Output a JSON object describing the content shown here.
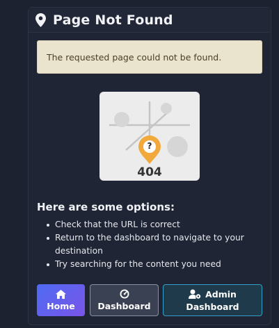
{
  "panel": {
    "title": "Page Not Found",
    "title_icon": "map-pin-icon"
  },
  "alert": {
    "message": "The requested page could not be found."
  },
  "illustration": {
    "icon": "map-question-marker-icon",
    "marker_symbol": "?",
    "code": "404"
  },
  "options": {
    "heading": "Here are some options:",
    "items": [
      "Check that the URL is correct",
      "Return to the dashboard to navigate to your destination",
      "Try searching for the content you need"
    ]
  },
  "buttons": {
    "home": {
      "label": "Home",
      "icon": "home-icon"
    },
    "dashboard": {
      "label": "Dashboard",
      "icon": "gauge-icon"
    },
    "admin": {
      "label_line1": "Admin",
      "label_line2": "Dashboard",
      "icon": "user-gear-icon"
    }
  },
  "colors": {
    "page_background": "#1c2230",
    "panel_background": "#1f2535",
    "alert_background": "#eae4cf",
    "alert_text": "#4b4026",
    "home_gradient_start": "#4e6bf3",
    "home_gradient_end": "#7a55e8",
    "admin_border": "#2ea3c7",
    "marker": "#f2a93b"
  }
}
